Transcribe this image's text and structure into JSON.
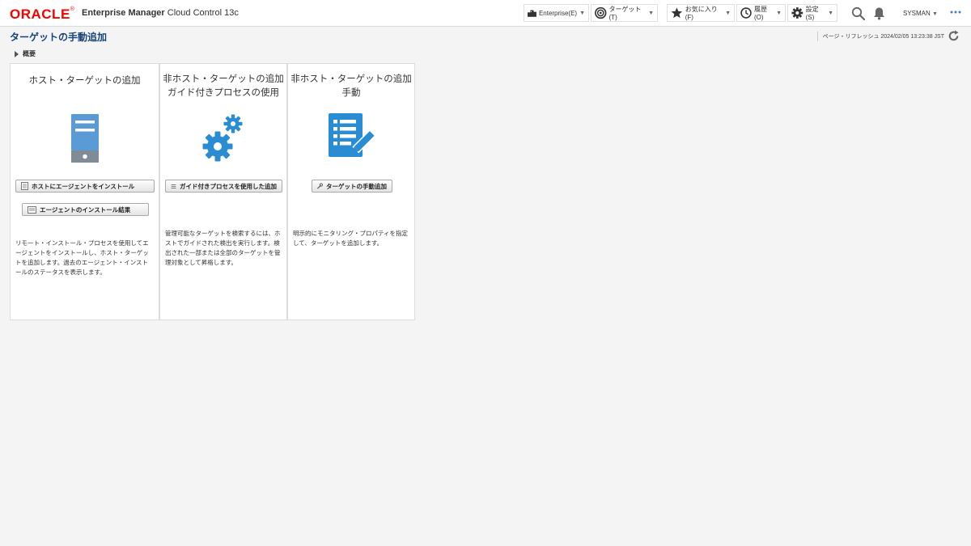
{
  "header": {
    "logo": "ORACLE",
    "product_bold": "Enterprise Manager",
    "product_rest": "Cloud Control 13c",
    "menus": [
      {
        "label": "Enterprise(E)",
        "icon": "enterprise-icon"
      },
      {
        "label": "ターゲット(T)",
        "icon": "target-icon"
      },
      {
        "label": "お気に入り(F)",
        "icon": "star-icon"
      },
      {
        "label": "履歴(O)",
        "icon": "clock-icon"
      },
      {
        "label": "設定(S)",
        "icon": "gear-icon"
      }
    ],
    "user": "SYSMAN"
  },
  "page": {
    "title": "ターゲットの手動追加",
    "refresh_label": "ページ・リフレッシュ 2024/02/05 13:23:38 JST",
    "overview": "概要"
  },
  "cards": [
    {
      "title": "ホスト・ターゲットの追加",
      "icon": "server-icon",
      "buttons": [
        "ホストにエージェントをインストール",
        "エージェントのインストール結果"
      ],
      "description": [
        "リモート・インストール・プロセスを使用してエ",
        "ージェントをインストールし、ホスト・ターゲッ",
        "トを追加します。過去のエージェント・インスト",
        "ールのステータスを表示します。"
      ]
    },
    {
      "title_lines": [
        "非ホスト・ターゲットの追加",
        "ガイド付きプロセスの使用"
      ],
      "icon": "gears-icon",
      "buttons": [
        "ガイド付きプロセスを使用した追加"
      ],
      "description": [
        "管理可能なターゲットを検索するには、ホ",
        "ストでガイドされた検出を実行します。検",
        "出された一部または全部のターゲットを管",
        "理対象として昇格します。"
      ]
    },
    {
      "title_lines": [
        "非ホスト・ターゲットの追加",
        "手動"
      ],
      "icon": "list-edit-icon",
      "buttons": [
        "ターゲットの手動追加"
      ],
      "description": [
        "明示的にモニタリング・プロパティを指定",
        "して、ターゲットを追加します。"
      ]
    }
  ]
}
